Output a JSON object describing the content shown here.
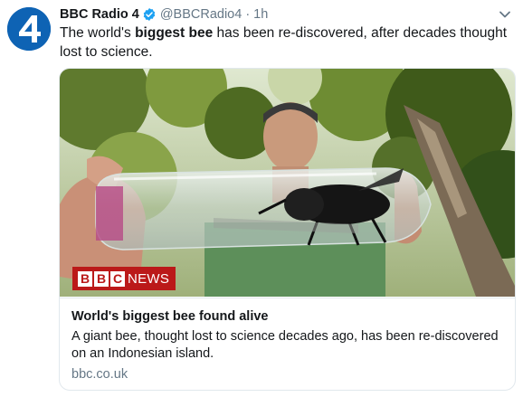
{
  "tweet": {
    "avatar_label": "4",
    "display_name": "BBC Radio 4",
    "handle": "@BBCRadio4",
    "separator": "·",
    "time": "1h",
    "text_before": "The world's ",
    "text_bold": "biggest bee",
    "text_after": " has been re-discovered, after decades thought lost to science."
  },
  "card": {
    "logo": {
      "letters": [
        "B",
        "B",
        "C"
      ],
      "word": "NEWS"
    },
    "title": "World's biggest bee found alive",
    "description": "A giant bee, thought lost to science decades ago, has been re-discovered on an Indonesian island.",
    "domain": "bbc.co.uk"
  },
  "icons": {
    "verified": "verified-badge-icon",
    "caret": "chevron-down-icon"
  },
  "colors": {
    "avatar_bg": "#0e63b4",
    "verified": "#1da1f2",
    "bbc_red": "#bb1919",
    "muted_text": "#657786",
    "card_border": "#e1e8ed"
  }
}
